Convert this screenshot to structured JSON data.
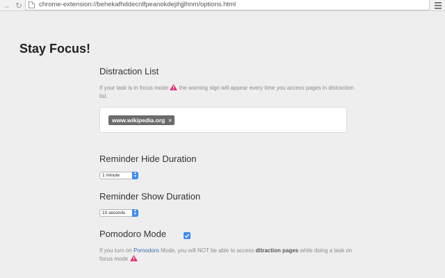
{
  "browser": {
    "url": "chrome-extension://behekafhddecnlfpeanokdejihjjlhnm/options.html",
    "icons": {
      "forward": "forward-arrow-icon",
      "reload": "reload-icon",
      "page": "page-icon",
      "bookmark": "star-icon",
      "menu": "menu-icon"
    }
  },
  "app": {
    "title": "Stay Focus!"
  },
  "distraction": {
    "heading": "Distraction List",
    "help_before": "If your task is in focus mode",
    "help_after": "the warning sign will appear every time you access pages in distraction list.",
    "tags": [
      {
        "label": "www.wikipedia.org",
        "remove": "×"
      }
    ]
  },
  "reminder_hide": {
    "heading": "Reminder Hide Duration",
    "selected": "1 minute"
  },
  "reminder_show": {
    "heading": "Reminder Show Duration",
    "selected": "10 seconds"
  },
  "pomodoro": {
    "heading": "Pomodoro Mode",
    "checked": true,
    "help_1": "If you turn on",
    "help_link": "Pomodoro",
    "help_2": "Mode, you will NOT be able to access",
    "help_bold": "ditraction pages",
    "help_3": "while doing a task on focus mode"
  },
  "colors": {
    "accent": "#3d8cf0",
    "warning": "#e0307a",
    "tag_bg": "#6b6b6b"
  }
}
